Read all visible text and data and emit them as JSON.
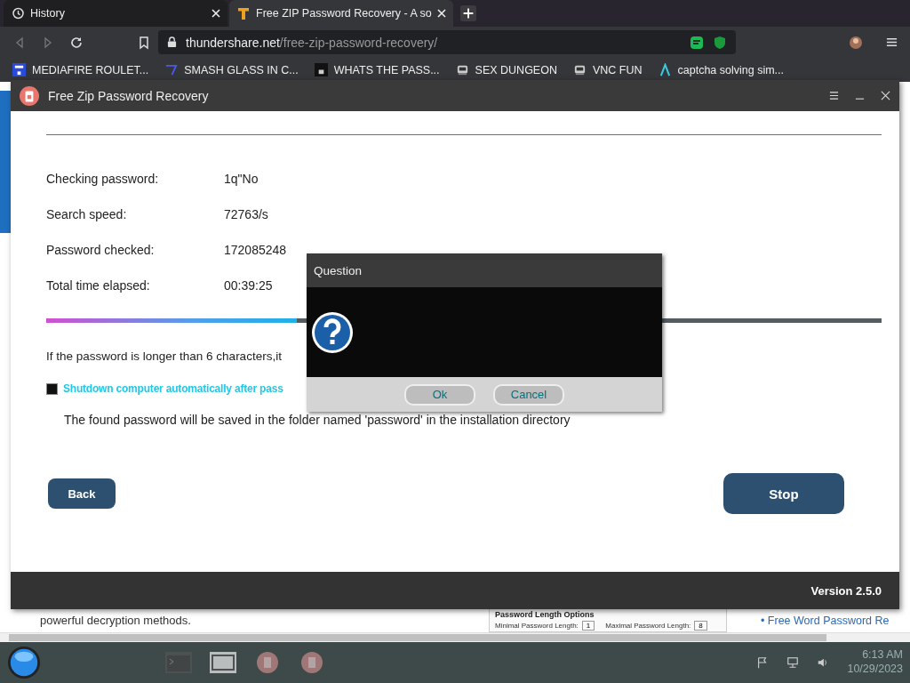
{
  "browser": {
    "tabs": [
      {
        "title": "History",
        "selected": false
      },
      {
        "title": "Free ZIP Password Recovery - A so",
        "selected": true
      }
    ],
    "url": {
      "domain": "thundershare.net",
      "path": "/free-zip-password-recovery/"
    },
    "bookmarks": [
      {
        "label": "MEDIAFIRE ROULET..."
      },
      {
        "label": "SMASH GLASS IN C..."
      },
      {
        "label": "WHATS THE PASS..."
      },
      {
        "label": "SEX DUNGEON"
      },
      {
        "label": "VNC FUN"
      },
      {
        "label": "captcha solving sim..."
      }
    ]
  },
  "app": {
    "title": "Free Zip Password Recovery",
    "stats": [
      {
        "label": "Checking password:",
        "value": "1q\"No"
      },
      {
        "label": "Search speed:",
        "value": "72763/s"
      },
      {
        "label": "Password checked:",
        "value": "172085248"
      },
      {
        "label": "Total time elapsed:",
        "value": "00:39:25"
      }
    ],
    "progress": {
      "level": 0.3
    },
    "length_note": "If the password is longer than 6 characters,it",
    "shutdown": {
      "label": "Shutdown computer automatically after pass",
      "checked": true
    },
    "save_note": "The found password will be saved in the folder named 'password' in the installation directory",
    "back_button": "Back",
    "stop_button": "Stop",
    "version": "Version 2.5.0"
  },
  "dialog": {
    "title": "Question",
    "buttons": [
      {
        "label": "Ok"
      },
      {
        "label": "Cancel"
      }
    ]
  },
  "page_behind": {
    "text": "powerful decryption methods.",
    "thumbnail_title": "Password Length Options",
    "thumbnail_fields": [
      {
        "label": "Minimal Password Length:",
        "value": "1"
      },
      {
        "label": "Maximal Password Length:",
        "value": "8"
      }
    ],
    "link": "• Free Word Password Re"
  },
  "taskbar": {
    "time": "6:13 AM",
    "date": "10/29/2023"
  }
}
